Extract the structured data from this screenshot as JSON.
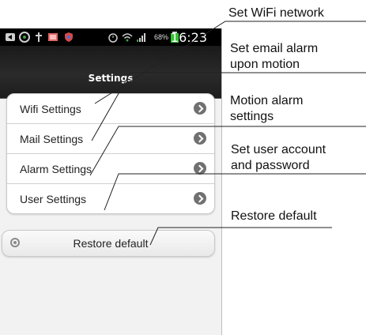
{
  "status_bar": {
    "battery_percent": "68%",
    "clock": "16:23"
  },
  "header": {
    "title": "Settings"
  },
  "settings_list": {
    "items": [
      {
        "label": "Wifi Settings"
      },
      {
        "label": "Mail Settings"
      },
      {
        "label": "Alarm Settings"
      },
      {
        "label": "User Settings"
      }
    ]
  },
  "restore": {
    "label": "Restore default"
  },
  "annotations": {
    "wifi": "Set WiFi network",
    "email_line1": "Set email alarm",
    "email_line2": "upon motion",
    "motion_line1": "Motion alarm",
    "motion_line2": "settings",
    "user_line1": "Set user account",
    "user_line2": "and password",
    "restore": "Restore default"
  },
  "icons": [
    "back-icon",
    "sync-icon",
    "usb-icon",
    "image-icon",
    "shield-icon",
    "alarm-clock-icon",
    "wifi-icon",
    "signal-icon",
    "battery-icon",
    "chevron-right-icon",
    "restore-icon"
  ],
  "colors": {
    "title_bar": "#1f1f1f",
    "chevron": "#707070",
    "screen_bg": "#f2f2f2"
  }
}
